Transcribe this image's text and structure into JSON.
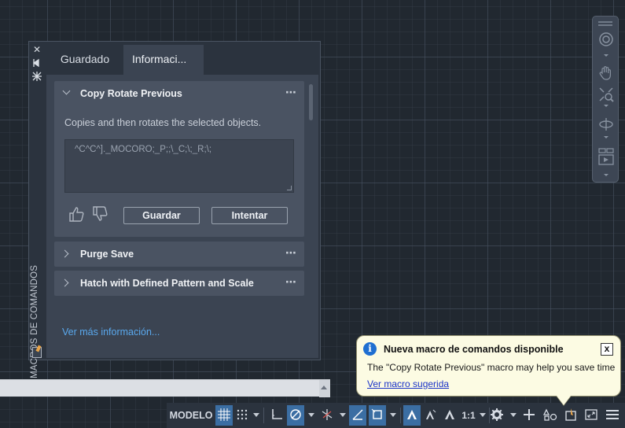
{
  "palette": {
    "vertical_title": "MACROS DE COMANDOS",
    "strip_buttons": [
      "close-icon",
      "auto-hide-icon",
      "properties-icon"
    ],
    "tabs": [
      {
        "label": "Guardado",
        "active": false
      },
      {
        "label": "Informaci...",
        "active": true
      }
    ],
    "cards": [
      {
        "title": "Copy Rotate Previous",
        "expanded": true,
        "description": "Copies and then rotates the selected objects.",
        "macro": "^C^C^]._MOCORO;_P;;\\_C;\\;_R;\\;",
        "buttons": {
          "save": "Guardar",
          "try": "Intentar"
        },
        "more_menu": "⋯"
      },
      {
        "title": "Purge Save",
        "expanded": false,
        "more_menu": "⋯"
      },
      {
        "title": "Hatch with Defined Pattern and Scale",
        "expanded": false,
        "more_menu": "⋯"
      }
    ],
    "more_info_link": "Ver más información..."
  },
  "statusbar": {
    "model_label": "MODELO",
    "scale_label": "1:1",
    "accent": "#3b6ea3"
  },
  "notification": {
    "title": "Nueva macro de comandos disponible",
    "body": "The \"Copy Rotate Previous\" macro may help you save time",
    "link": "Ver macro sugerida",
    "close_label": "x"
  }
}
